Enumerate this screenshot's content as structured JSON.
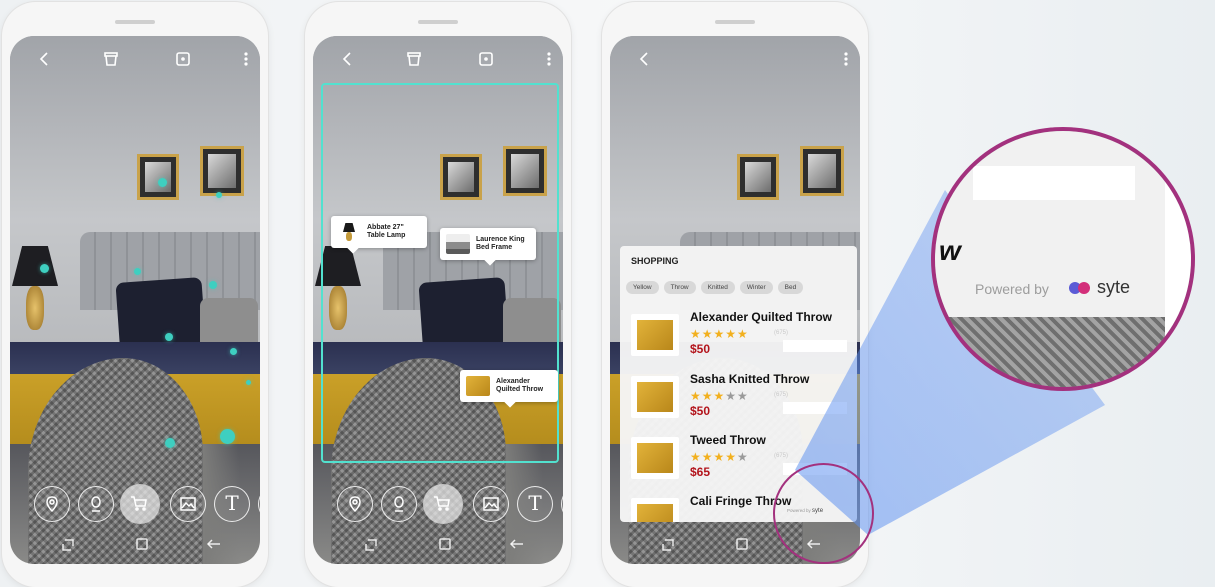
{
  "screens": [
    {
      "id": "scan"
    },
    {
      "id": "detect",
      "tags": [
        {
          "label": "Abbate 27\"\nTable Lamp"
        },
        {
          "label": "Laurence King\nBed Frame"
        },
        {
          "label": "Alexander\nQuilted Throw"
        }
      ]
    },
    {
      "id": "shopping"
    }
  ],
  "shopping": {
    "title": "SHOPPING",
    "filters": [
      "Yellow",
      "Throw",
      "Knitted",
      "Winter",
      "Bed"
    ],
    "items": [
      {
        "name": "Alexander Quilted Throw",
        "rating": 5,
        "count": "(675)",
        "price": "$50"
      },
      {
        "name": "Sasha Knitted Throw",
        "rating": 3,
        "count": "(675)",
        "price": "$50"
      },
      {
        "name": "Tweed Throw",
        "rating": 4,
        "count": "(675)",
        "price": "$65"
      },
      {
        "name": "Cali Fringe Throw",
        "rating": 0,
        "count": "",
        "price": ""
      }
    ],
    "powered_small_prefix": "Powered by",
    "powered_small_brand": "syte"
  },
  "zoom": {
    "fragment": "w",
    "powered_by": "Powered by",
    "brand": "syte"
  },
  "colors": {
    "accent": "#52e1cf",
    "dot": "#3ecfc0",
    "price": "#b3141c",
    "star": "#f2b01e",
    "zoom_ring": "#a3317e",
    "beam": "#5b8ff0"
  },
  "icons": {
    "top": [
      "back-icon",
      "delete-icon",
      "crop-icon",
      "more-icon"
    ],
    "tools": [
      "location-icon",
      "face-icon",
      "shopping-cart-icon",
      "image-icon",
      "text-icon"
    ],
    "nav": [
      "recent-apps-icon",
      "home-icon",
      "back-nav-icon"
    ]
  }
}
